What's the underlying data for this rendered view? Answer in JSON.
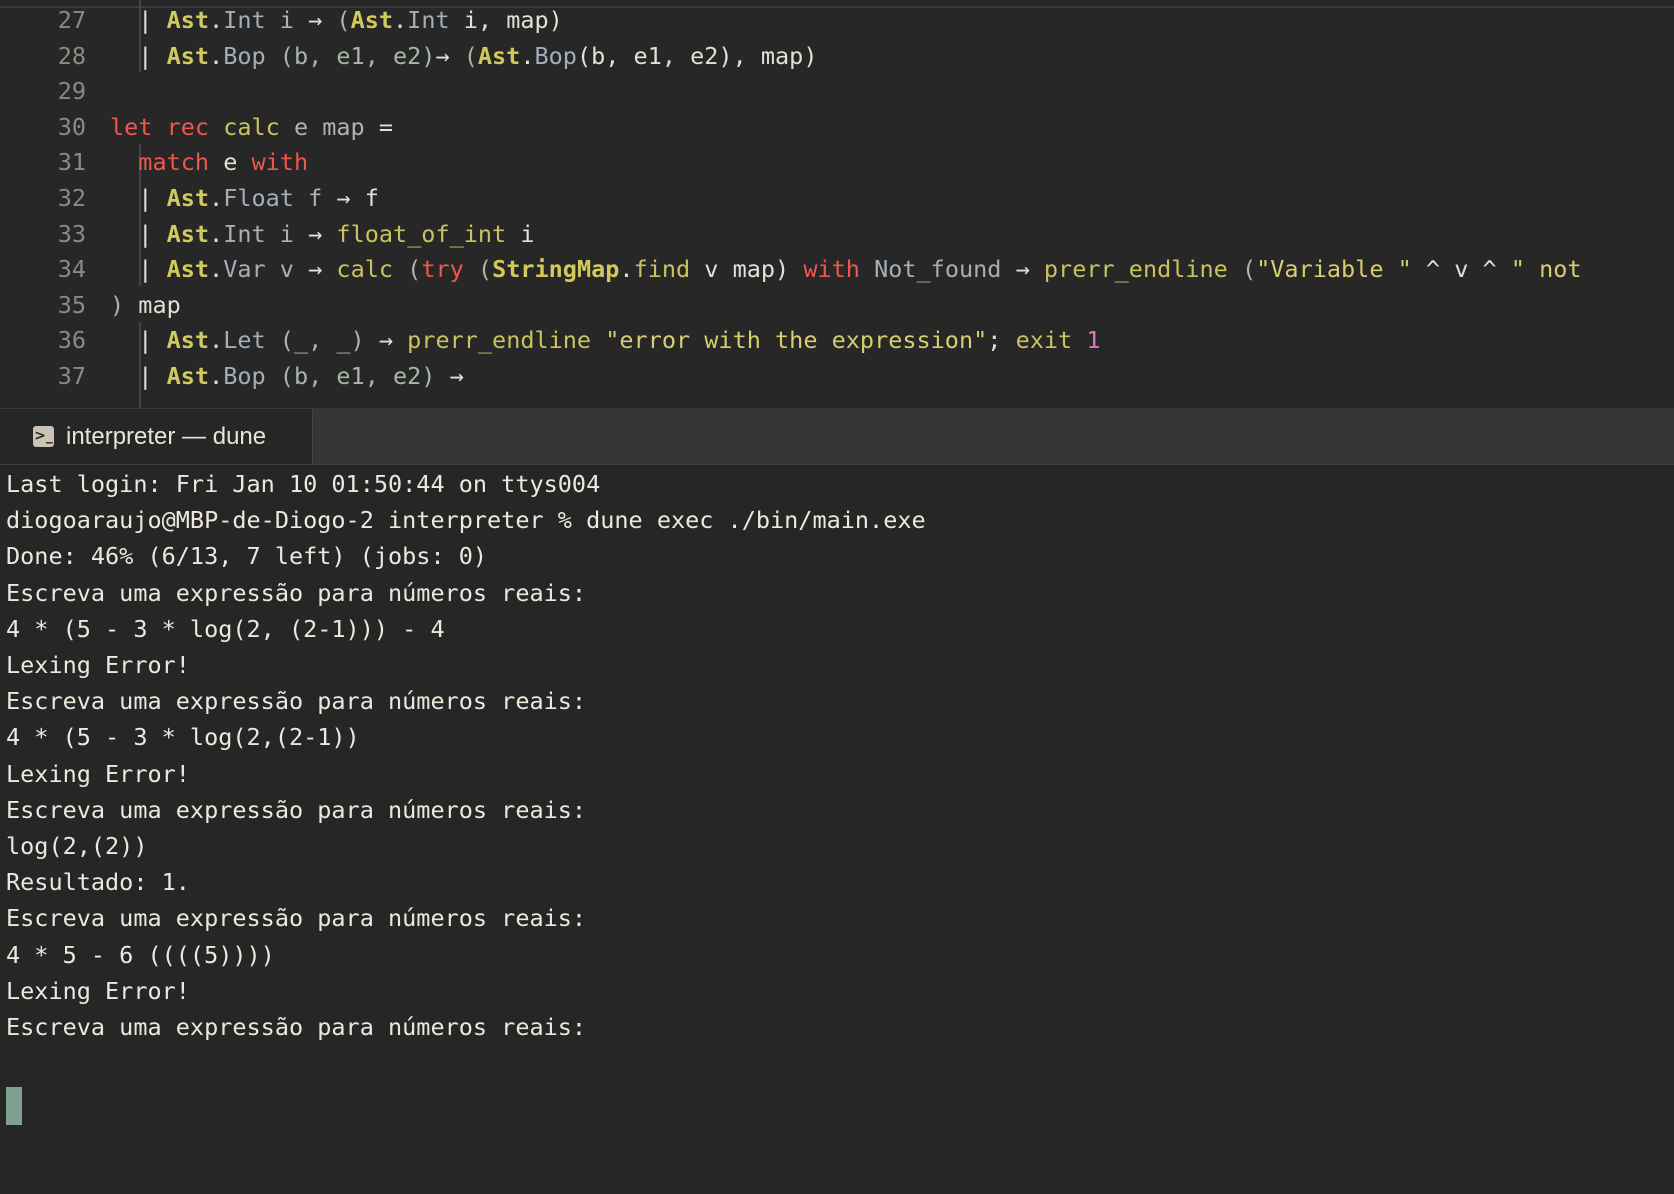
{
  "editor": {
    "lines": [
      {
        "num": "27",
        "tokens": [
          {
            "t": "  | ",
            "c": "pl"
          },
          {
            "t": "Ast",
            "c": "ty"
          },
          {
            "t": ".",
            "c": "pl"
          },
          {
            "t": "Int",
            "c": "cs"
          },
          {
            "t": " i ",
            "c": "id"
          },
          {
            "t": "→",
            "c": "pl"
          },
          {
            "t": " (",
            "c": "pm"
          },
          {
            "t": "Ast",
            "c": "ty"
          },
          {
            "t": ".",
            "c": "pl"
          },
          {
            "t": "Int",
            "c": "cs"
          },
          {
            "t": " i, map)",
            "c": "pl"
          }
        ]
      },
      {
        "num": "28",
        "tokens": [
          {
            "t": "  | ",
            "c": "pl"
          },
          {
            "t": "Ast",
            "c": "ty"
          },
          {
            "t": ".",
            "c": "pl"
          },
          {
            "t": "Bop",
            "c": "cs"
          },
          {
            "t": " (b, e1, e2)",
            "c": "id"
          },
          {
            "t": "→",
            "c": "pl"
          },
          {
            "t": " (",
            "c": "pm"
          },
          {
            "t": "Ast",
            "c": "ty"
          },
          {
            "t": ".",
            "c": "pl"
          },
          {
            "t": "Bop",
            "c": "cs"
          },
          {
            "t": "(b, e1, e2), map)",
            "c": "pl"
          }
        ]
      },
      {
        "num": "29",
        "tokens": []
      },
      {
        "num": "30",
        "tokens": [
          {
            "t": "let",
            "c": "kw"
          },
          {
            "t": " ",
            "c": "pl"
          },
          {
            "t": "rec",
            "c": "kw"
          },
          {
            "t": " ",
            "c": "pl"
          },
          {
            "t": "calc",
            "c": "fn"
          },
          {
            "t": " e map",
            "c": "id"
          },
          {
            "t": " =",
            "c": "pl"
          }
        ]
      },
      {
        "num": "31",
        "tokens": [
          {
            "t": "  ",
            "c": "pl"
          },
          {
            "t": "match",
            "c": "kw"
          },
          {
            "t": " e ",
            "c": "pl"
          },
          {
            "t": "with",
            "c": "kw"
          }
        ]
      },
      {
        "num": "32",
        "tokens": [
          {
            "t": "  | ",
            "c": "pl"
          },
          {
            "t": "Ast",
            "c": "ty"
          },
          {
            "t": ".",
            "c": "pl"
          },
          {
            "t": "Float",
            "c": "cs"
          },
          {
            "t": " f ",
            "c": "id"
          },
          {
            "t": "→",
            "c": "pl"
          },
          {
            "t": " f",
            "c": "pl"
          }
        ]
      },
      {
        "num": "33",
        "tokens": [
          {
            "t": "  | ",
            "c": "pl"
          },
          {
            "t": "Ast",
            "c": "ty"
          },
          {
            "t": ".",
            "c": "pl"
          },
          {
            "t": "Int",
            "c": "cs"
          },
          {
            "t": " i ",
            "c": "id"
          },
          {
            "t": "→",
            "c": "pl"
          },
          {
            "t": " ",
            "c": "pl"
          },
          {
            "t": "float_of_int",
            "c": "fn"
          },
          {
            "t": " i",
            "c": "pl"
          }
        ]
      },
      {
        "num": "34",
        "tokens": [
          {
            "t": "  | ",
            "c": "pl"
          },
          {
            "t": "Ast",
            "c": "ty"
          },
          {
            "t": ".",
            "c": "pl"
          },
          {
            "t": "Var",
            "c": "cs"
          },
          {
            "t": " v ",
            "c": "id"
          },
          {
            "t": "→",
            "c": "pl"
          },
          {
            "t": " ",
            "c": "pl"
          },
          {
            "t": "calc",
            "c": "fn"
          },
          {
            "t": " (",
            "c": "pm"
          },
          {
            "t": "try",
            "c": "kw"
          },
          {
            "t": " (",
            "c": "pm"
          },
          {
            "t": "StringMap",
            "c": "ty"
          },
          {
            "t": ".",
            "c": "pl"
          },
          {
            "t": "find",
            "c": "fn"
          },
          {
            "t": " v map) ",
            "c": "pl"
          },
          {
            "t": "with",
            "c": "kw"
          },
          {
            "t": " ",
            "c": "pl"
          },
          {
            "t": "Not_found",
            "c": "cs"
          },
          {
            "t": " ",
            "c": "pl"
          },
          {
            "t": "→",
            "c": "pl"
          },
          {
            "t": " ",
            "c": "pl"
          },
          {
            "t": "prerr_endline",
            "c": "fn"
          },
          {
            "t": " (",
            "c": "pm"
          },
          {
            "t": "\"Variable \"",
            "c": "str"
          },
          {
            "t": " ^ v ^ ",
            "c": "pl"
          },
          {
            "t": "\" not",
            "c": "str"
          }
        ]
      },
      {
        "num": "35",
        "tokens": [
          {
            "t": ") ",
            "c": "pm"
          },
          {
            "t": "map",
            "c": "pl"
          }
        ]
      },
      {
        "num": "36",
        "tokens": [
          {
            "t": "  | ",
            "c": "pl"
          },
          {
            "t": "Ast",
            "c": "ty"
          },
          {
            "t": ".",
            "c": "pl"
          },
          {
            "t": "Let",
            "c": "cs"
          },
          {
            "t": " (_, _) ",
            "c": "id"
          },
          {
            "t": "→",
            "c": "pl"
          },
          {
            "t": " ",
            "c": "pl"
          },
          {
            "t": "prerr_endline",
            "c": "fn"
          },
          {
            "t": " ",
            "c": "pl"
          },
          {
            "t": "\"error with the expression\"",
            "c": "str"
          },
          {
            "t": "; ",
            "c": "pl"
          },
          {
            "t": "exit",
            "c": "fn"
          },
          {
            "t": " ",
            "c": "pl"
          },
          {
            "t": "1",
            "c": "num"
          }
        ]
      },
      {
        "num": "37",
        "tokens": [
          {
            "t": "  | ",
            "c": "pl"
          },
          {
            "t": "Ast",
            "c": "ty"
          },
          {
            "t": ".",
            "c": "pl"
          },
          {
            "t": "Bop",
            "c": "cs"
          },
          {
            "t": " (b, e1, e2) ",
            "c": "id"
          },
          {
            "t": "→",
            "c": "pl"
          }
        ]
      }
    ]
  },
  "terminal_tab": {
    "icon": "terminal-prompt-icon",
    "label": "interpreter — dune"
  },
  "terminal": {
    "lines": [
      "Last login: Fri Jan 10 01:50:44 on ttys004",
      "diogoaraujo@MBP-de-Diogo-2 interpreter % dune exec ./bin/main.exe",
      "Done: 46% (6/13, 7 left) (jobs: 0)",
      "Escreva uma expressão para números reais:",
      "4 * (5 - 3 * log(2, (2-1))) - 4",
      "Lexing Error!",
      "Escreva uma expressão para números reais:",
      "4 * (5 - 3 * log(2,(2-1))",
      "Lexing Error!",
      "Escreva uma expressão para números reais:",
      "log(2,(2))",
      "Resultado: 1.",
      "Escreva uma expressão para números reais:",
      "4 * 5 - 6 ((((5))))",
      "Lexing Error!",
      "Escreva uma expressão para números reais:"
    ]
  },
  "colors": {
    "background": "#262626",
    "keyword": "#f0564b",
    "function": "#c9c35d",
    "module": "#d1c95a",
    "string": "#d7cf6d",
    "number": "#d97bb5",
    "cursor": "#7fa08e"
  }
}
